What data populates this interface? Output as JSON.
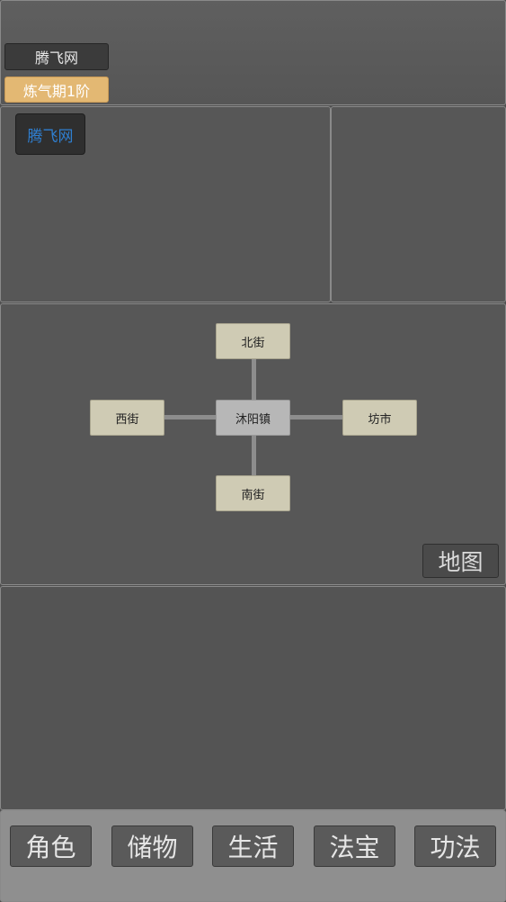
{
  "header": {
    "player_name": "腾飞网",
    "realm": "炼气期1阶"
  },
  "info": {
    "npc_label": "腾飞网"
  },
  "map": {
    "north": "北街",
    "west": "西街",
    "center": "沐阳镇",
    "east": "坊市",
    "south": "南街",
    "map_button": "地图"
  },
  "tabs": [
    {
      "label": "角色"
    },
    {
      "label": "储物"
    },
    {
      "label": "生活"
    },
    {
      "label": "法宝"
    },
    {
      "label": "功法"
    }
  ],
  "colors": {
    "realm_badge": "#e3b873",
    "npc_text": "#2f7fd1",
    "location_node": "#cfcbb4",
    "current_location": "#b7b7b7"
  }
}
